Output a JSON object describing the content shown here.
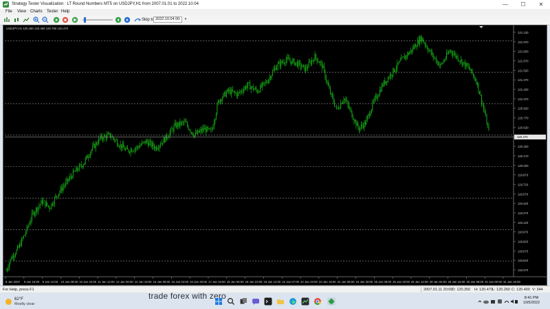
{
  "window": {
    "title": "Strategy Tester Visualization : LT Round Numbers MT5 on USDJPY,H1 from 2007.01.01 to 2022.10.04",
    "minimize": "—",
    "maximize": "☐",
    "close": "✕"
  },
  "menu": {
    "items": [
      "File",
      "View",
      "Charts",
      "Tester",
      "Help"
    ]
  },
  "toolbar": {
    "skip_label": "Skip to",
    "skip_date": "2022.10.04 00:00"
  },
  "chart": {
    "info": "USDJPY,H1  120.450  120.460  120.760  120.470",
    "price_labels": [
      "121.120",
      "121.970",
      "121.820",
      "121.670",
      "121.520",
      "121.370",
      "121.220",
      "121.070",
      "120.920",
      "120.770",
      "120.620",
      "120.470",
      "120.320",
      "120.170",
      "120.020",
      "119.870",
      "119.720",
      "119.570",
      "119.420",
      "119.270",
      "119.120",
      "118.970",
      "118.820",
      "118.670",
      "118.520",
      "118.370"
    ],
    "current_price": "120.470",
    "date_labels": [
      "8 Jan 2007",
      "9 Jan 16:00",
      "9 Jan 12:00",
      "10 Jan 08:00",
      "10 Jan 22:00",
      "11 Jan 12:00",
      "12 Jan 00:00",
      "12 Jan 18:00",
      "15 Jan 08:00",
      "16 Jan 04:00",
      "16 Jan 20:00",
      "17 Jan 16:00",
      "18 Jan 06:00",
      "18 Jan 22:00",
      "19 Jan 12:00",
      "22 Jan 07:00",
      "22 Jan 23:00",
      "23 Jan 16:00",
      "24 Jan 08:00",
      "24 Jan 20:00",
      "25 Jan 08:00",
      "25 Jan 20:00",
      "26 Jan 12:00",
      "29 Jan 04:00",
      "29 Jan 16:00",
      "30 Jan 08:00",
      "31 Jan 00:00",
      "31 Jan 16:00"
    ],
    "round_levels": [
      "122.000",
      "121.500",
      "121.000",
      "120.500",
      "120.000",
      "119.500",
      "119.000",
      "118.500"
    ]
  },
  "status": {
    "help": "For Help, press F1",
    "datetime": "2007.01.11 20:00",
    "open": "O: 120.350",
    "high": "H: 120.470",
    "low": "L: 120.260",
    "close": "C: 120.400",
    "volume": "V: 344"
  },
  "taskbar": {
    "temp": "62°F",
    "condition": "Mostly clear",
    "ad_text": "trade forex with zero",
    "time": "8:41 PM",
    "date": "10/5/2022"
  },
  "colors": {
    "candles": "#18b418",
    "chart_bg": "#000000",
    "grid_dash": "#9a9a9a",
    "axis_text": "#cfcfcf"
  }
}
